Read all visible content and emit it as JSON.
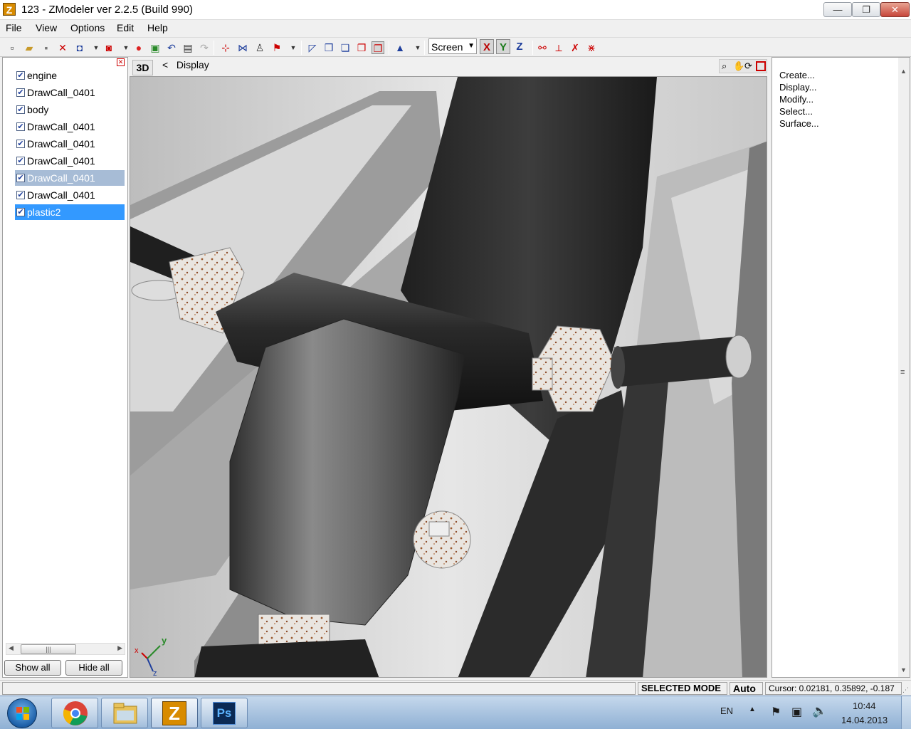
{
  "window": {
    "app_icon_letter": "Z",
    "title": "123 - ZModeler ver 2.2.5 (Build 990)",
    "controls": {
      "minimize": "—",
      "maximize": "❐",
      "close": "✕"
    }
  },
  "menu": {
    "file": "File",
    "view": "View",
    "options": "Options",
    "edit": "Edit",
    "help": "Help"
  },
  "toolbar": {
    "view_mode": "Screen",
    "axis_x": "X",
    "axis_y": "Y",
    "axis_z": "Z"
  },
  "objects_panel": {
    "items": [
      {
        "label": "engine",
        "checked": true,
        "state": "normal"
      },
      {
        "label": "DrawCall_0401",
        "checked": true,
        "state": "normal"
      },
      {
        "label": "body",
        "checked": true,
        "state": "normal"
      },
      {
        "label": "DrawCall_0401",
        "checked": true,
        "state": "normal"
      },
      {
        "label": "DrawCall_0401",
        "checked": true,
        "state": "normal"
      },
      {
        "label": "DrawCall_0401",
        "checked": true,
        "state": "normal"
      },
      {
        "label": "DrawCall_0401",
        "checked": true,
        "state": "selected-inactive"
      },
      {
        "label": "DrawCall_0401",
        "checked": true,
        "state": "normal"
      },
      {
        "label": "plastic2",
        "checked": true,
        "state": "selected"
      }
    ],
    "show_all": "Show all",
    "hide_all": "Hide all"
  },
  "viewport": {
    "mode_tab": "3D",
    "back_arrow": "<",
    "breadcrumb": "Display",
    "gizmo": {
      "x": "x",
      "y": "y",
      "z": "z"
    }
  },
  "commands_panel": {
    "items": [
      "Create...",
      "Display...",
      "Modify...",
      "Select...",
      "Surface..."
    ]
  },
  "status": {
    "mode": "SELECTED MODE",
    "auto": "Auto",
    "cursor": "Cursor: 0.02181, 0.35892, -0.187"
  },
  "taskbar": {
    "language": "EN",
    "time": "10:44",
    "date": "14.04.2013",
    "photoshop_label": "Ps",
    "zmodeler_label": "Z"
  },
  "colors": {
    "selection_blue": "#3399ff",
    "selection_inactive": "#a7bcd6",
    "taskbar": "#a9c3e0"
  }
}
